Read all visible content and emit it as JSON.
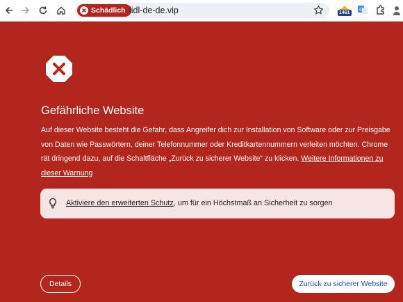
{
  "browser": {
    "security_chip": "Schädlich",
    "url": "lidl-de-de.vip",
    "extension_badge": "1461"
  },
  "page": {
    "heading": "Gefährliche Website",
    "body": "Auf dieser Website besteht die Gefahr, dass Angreifer dich zur Installation von Software oder zur Preisgabe von Daten wie Passwörtern, deiner Telefonnummer oder Kreditkartennummern verleiten möchten. Chrome rät dringend dazu, auf die Schaltfläche „Zurück zu sicherer Website“ zu klicken. ",
    "more_info_link": "Weitere Informationen zu dieser Warnung",
    "tip_link": "Aktiviere den erweiterten Schutz",
    "tip_text": ", um für ein Höchstmaß an Sicherheit zu sorgen",
    "details_button": "Details",
    "back_button": "Zurück zu sicherer Website"
  },
  "colors": {
    "background": "#b3261e",
    "tip_background": "#f7e5e4",
    "button_text": "#1a57b8"
  },
  "icons": [
    "back-arrow-icon",
    "forward-arrow-icon",
    "reload-icon",
    "home-icon",
    "danger-x-icon",
    "star-icon",
    "extension-icon",
    "translate-icon",
    "puzzle-icon",
    "lightbulb-icon",
    "warning-shield-icon"
  ]
}
